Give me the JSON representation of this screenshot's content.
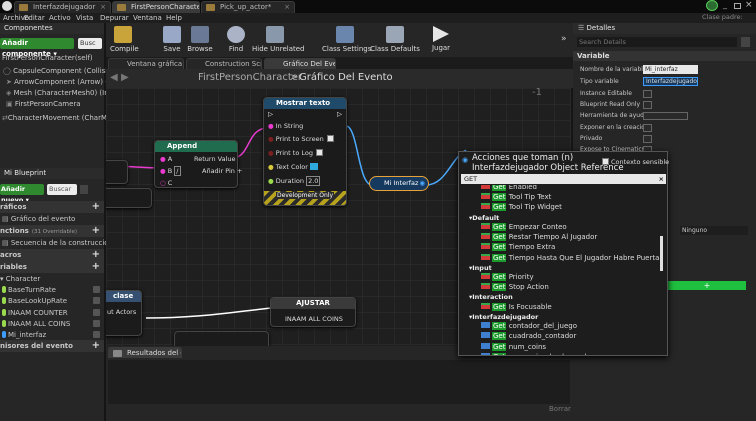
{
  "window": {
    "tabs": [
      "Interfazdejugador",
      "FirstPersonCharacter*",
      "Pick_up_actor*"
    ],
    "parent_class_label": "Clase padre:"
  },
  "menubar": [
    "Archivo",
    "Editar",
    "Activo",
    "Vista",
    "Depurar",
    "Ventana",
    "Help"
  ],
  "components_panel": {
    "title": "Componentes",
    "add_button": "Añadir componente ▾",
    "search_placeholder": "Busc",
    "items": [
      "FirstPersonCharacter(self)",
      "CapsuleComponent (CollisionCyl",
      "ArrowComponent (Arrow) (Inher",
      "Mesh (CharacterMesh0) (Inherit",
      "FirstPersonCamera",
      "CharacterMovement (CharMoveC"
    ]
  },
  "blueprint_panel": {
    "title": "Mi Blueprint",
    "add_new": "Añadir nuevo ▾",
    "search_placeholder": "Buscar",
    "rows": [
      {
        "text": "ráficos",
        "type": "section",
        "plus": true
      },
      {
        "text": "Gráfico del evento",
        "type": "item"
      },
      {
        "text": "nctions",
        "suffix": "(31 Overridable)",
        "type": "section",
        "plus": true
      },
      {
        "text": "Secuencia de la construcción",
        "type": "item"
      },
      {
        "text": "acros",
        "type": "section",
        "plus": true
      },
      {
        "text": "riables",
        "type": "section",
        "plus": true
      },
      {
        "text": "Character",
        "type": "subsection"
      },
      {
        "text": "BaseTurnRate",
        "type": "var"
      },
      {
        "text": "BaseLookUpRate",
        "type": "var"
      },
      {
        "text": "INAAM COUNTER",
        "type": "var"
      },
      {
        "text": "INAAM ALL COINS",
        "type": "var"
      },
      {
        "text": "Mi_interfaz",
        "type": "var"
      },
      {
        "text": "nisores del evento",
        "type": "section",
        "plus": true
      }
    ]
  },
  "toolbar": {
    "buttons": [
      {
        "label": "Compile",
        "icon": "compile-icon"
      },
      {
        "label": "Save",
        "icon": "save-icon"
      },
      {
        "label": "Browse",
        "icon": "browse-icon"
      },
      {
        "label": "Find",
        "icon": "binoculars-icon"
      },
      {
        "label": "Hide Unrelated",
        "icon": "hide-unrelated-icon"
      },
      {
        "label": "Class Settings",
        "icon": "class-settings-icon"
      },
      {
        "label": "Class Defaults",
        "icon": "class-defaults-icon"
      },
      {
        "label": "Jugar",
        "icon": "play-icon"
      }
    ]
  },
  "editor_tabs": [
    "Ventana gráfica",
    "Construction Scrip",
    "Gráfico Del Evento"
  ],
  "breadcrumb": {
    "root": "FirstPersonCharacter",
    "separator": ">",
    "current": "Gráfico Del Evento"
  },
  "zoom": "Zoom -1",
  "nodes": {
    "append": {
      "title": "Append",
      "pins_left": [
        "A",
        "B",
        "C"
      ],
      "b_value": "/",
      "return": "Return Value",
      "add_pin": "Añadir Pin"
    },
    "print": {
      "title": "Mostrar texto",
      "in_string": "In String",
      "print_screen": "Print to Screen",
      "print_log": "Print to Log",
      "text_color": "Text Color",
      "duration_label": "Duration",
      "duration_value": "2.0",
      "dev_only": "Development Only"
    },
    "interfaz": {
      "label": "Mi Interfaz"
    },
    "ajustar": {
      "title": "AJUSTAR",
      "pin": "INAAM ALL COINS"
    },
    "clase": {
      "title": "clase",
      "pin": "ut Actors"
    }
  },
  "popup": {
    "title": "Acciones que toman (n)",
    "subtitle": "Interfazdejugador Object Reference",
    "context_label": "Contexto sensible",
    "search_value": "GET",
    "items": [
      {
        "type": "item",
        "get": "Get",
        "text": " Enabled"
      },
      {
        "type": "item",
        "get": "Get",
        "text": " Tool Tip Text"
      },
      {
        "type": "item",
        "get": "Get",
        "text": " Tool Tip Widget"
      },
      {
        "type": "cat",
        "text": "Default"
      },
      {
        "type": "item",
        "get": "Get",
        "text": " Empezar Conteo"
      },
      {
        "type": "item",
        "get": "Get",
        "text": " Restar Tiempo Al Jugador"
      },
      {
        "type": "item",
        "get": "Get",
        "text": " Tiempo Extra"
      },
      {
        "type": "item",
        "get": "Get",
        "text": " Tiempo Hasta Que El Jugador Habre Puerta"
      },
      {
        "type": "cat",
        "text": "Input"
      },
      {
        "type": "item",
        "get": "Get",
        "text": " Priority"
      },
      {
        "type": "item",
        "get": "Get",
        "text": " Stop Action"
      },
      {
        "type": "cat",
        "text": "Interaction"
      },
      {
        "type": "item",
        "get": "Get",
        "text": " Is Focusable"
      },
      {
        "type": "cat",
        "text": "Interfazdejugador"
      },
      {
        "type": "var",
        "get": "Get",
        "text": " contador_del_juego"
      },
      {
        "type": "var",
        "get": "Get",
        "text": " cuadrado_contador"
      },
      {
        "type": "var",
        "get": "Get",
        "text": " num_coins"
      },
      {
        "type": "var",
        "get": "Get",
        "text": " num_coins_backround"
      }
    ]
  },
  "results_panel": {
    "title": "Resultados del co",
    "clear": "Borrar"
  },
  "details_panel": {
    "title": "Detalles",
    "search_placeholder": "Search Details",
    "section": "Variable",
    "rows": [
      {
        "label": "Nombre de la variable",
        "value": "Mi_interfaz"
      },
      {
        "label": "Tipo variable",
        "value": "Interfazdejugado"
      },
      {
        "label": "Instance Editable"
      },
      {
        "label": "Blueprint Read Only"
      },
      {
        "label": "Herramienta de ayuda"
      },
      {
        "label": "Exponer en la creación"
      },
      {
        "label": "Privado"
      },
      {
        "label": "Expose to Cinematics"
      }
    ],
    "category_value": "Ninguno"
  },
  "colors": {
    "accent": "#3e9eff",
    "play": "#2a2a2a",
    "green": "#1fbf3f",
    "append_head": "#206048",
    "print_head": "#1f4a6a"
  }
}
